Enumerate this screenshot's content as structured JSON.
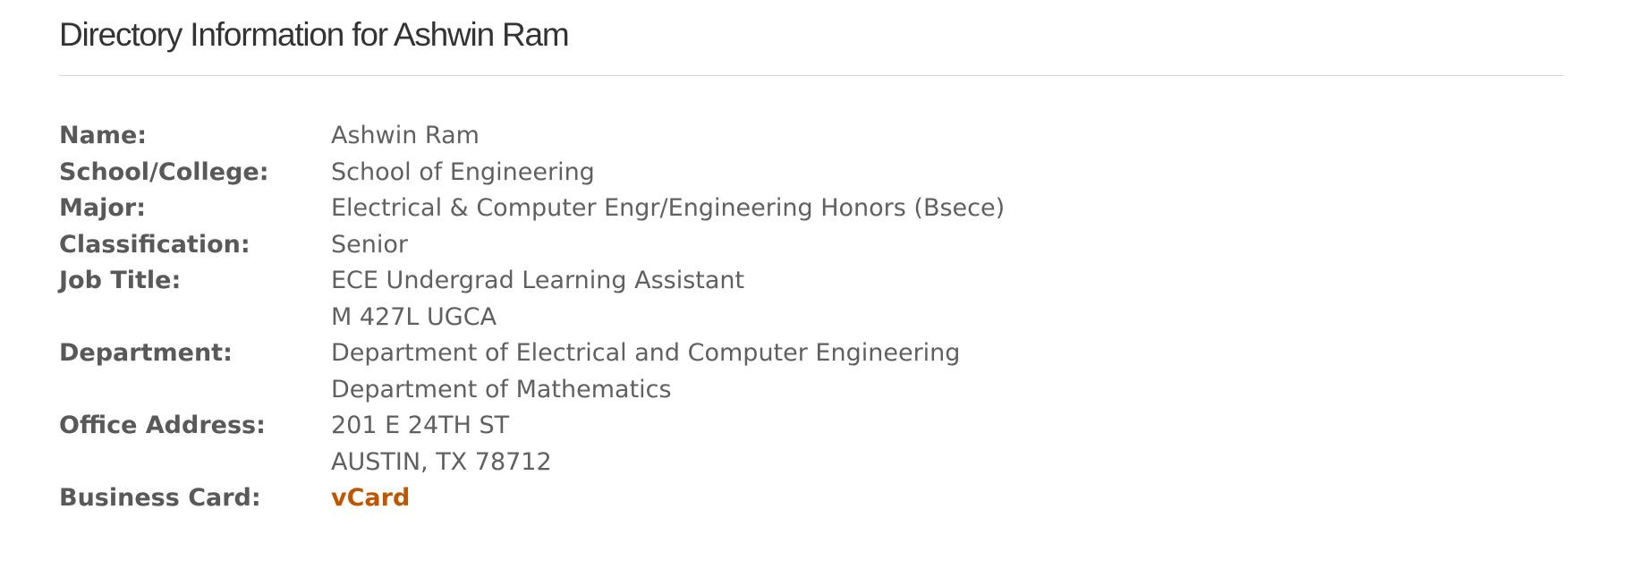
{
  "page": {
    "title": "Directory Information for Ashwin Ram"
  },
  "fields": {
    "name": {
      "label": "Name:",
      "value": "Ashwin Ram"
    },
    "school": {
      "label": "School/College:",
      "value": "School of Engineering"
    },
    "major": {
      "label": "Major:",
      "value": "Electrical & Computer Engr/Engineering Honors (Bsece)"
    },
    "classification": {
      "label": "Classification:",
      "value": "Senior"
    },
    "job_title": {
      "label": "Job Title:",
      "lines": [
        "ECE Undergrad Learning Assistant",
        "M 427L UGCA"
      ]
    },
    "department": {
      "label": "Department:",
      "lines": [
        "Department of Electrical and Computer Engineering",
        "Department of Mathematics"
      ]
    },
    "office_address": {
      "label": "Office Address:",
      "lines": [
        "201 E 24TH ST",
        "AUSTIN, TX 78712"
      ]
    },
    "business_card": {
      "label": "Business Card:",
      "link_text": "vCard"
    }
  },
  "colors": {
    "link": "#bf5700",
    "label_text": "#595959",
    "value_text": "#606060",
    "title_text": "#333333",
    "rule": "#d9d6d0"
  }
}
